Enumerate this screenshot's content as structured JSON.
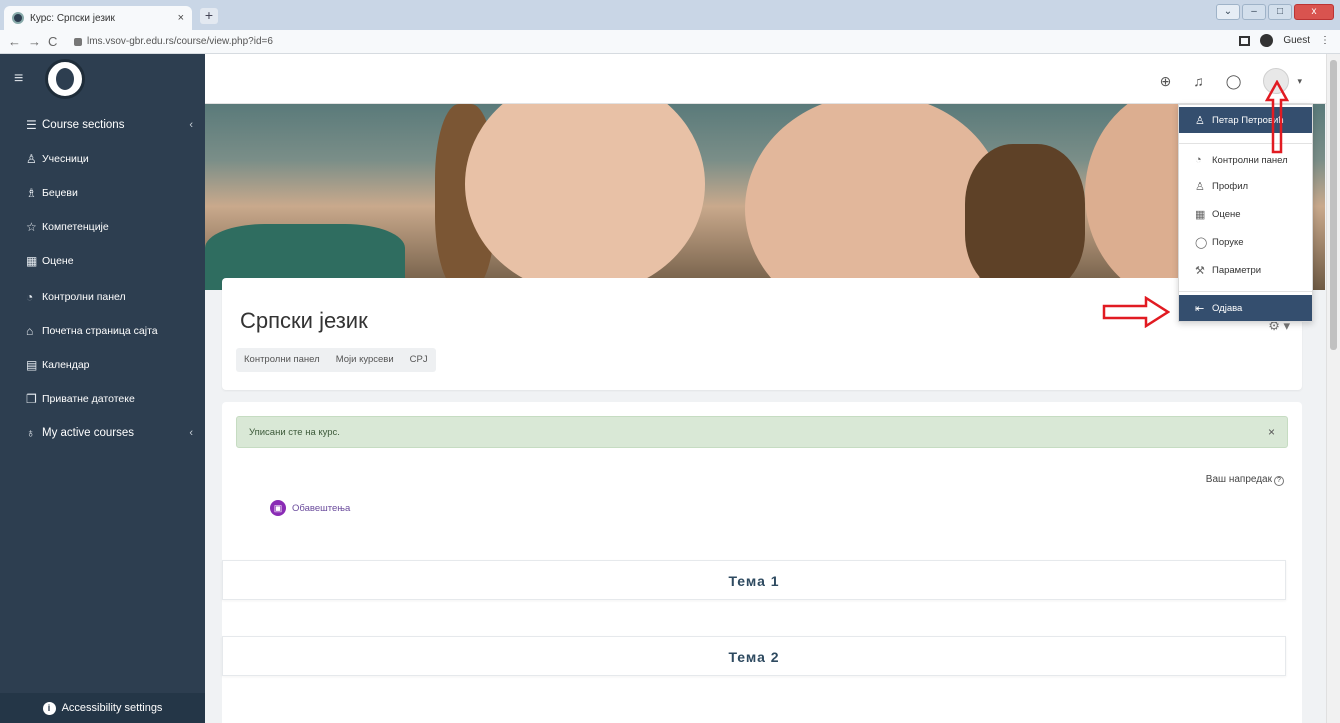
{
  "browser": {
    "tab_title": "Курс: Српски језик",
    "tab_close": "×",
    "new_tab": "+",
    "url": "lms.vsov-gbr.edu.rs/course/view.php?id=6",
    "profile_label": "Guest",
    "back": "←",
    "forward": "→",
    "reload": "C",
    "menu": "⋮"
  },
  "navbar": {
    "hamburger": "≡",
    "icons": [
      "globe-icon",
      "bell-icon",
      "chat-icon",
      "avatar"
    ],
    "caret": "▾"
  },
  "sidebar": {
    "items": [
      {
        "label": "Course sections",
        "icon": "list-icon",
        "chevron": "‹"
      },
      {
        "label": "Учесници",
        "icon": "users-icon"
      },
      {
        "label": "Беџеви",
        "icon": "badge-icon"
      },
      {
        "label": "Компетенције",
        "icon": "star-icon"
      },
      {
        "label": "Оцене",
        "icon": "grades-icon"
      },
      {
        "label": "Контролни панел",
        "icon": "dashboard-icon"
      },
      {
        "label": "Почетна страница сајта",
        "icon": "home-icon"
      },
      {
        "label": "Календар",
        "icon": "calendar-icon"
      },
      {
        "label": "Приватне датотеке",
        "icon": "files-icon"
      },
      {
        "label": "My active courses",
        "icon": "courses-icon",
        "chevron": "‹"
      }
    ],
    "accessibility": "Accessibility settings"
  },
  "course": {
    "title": "Српски језик",
    "breadcrumb": [
      "Контролни панел",
      "Моји курсеви",
      "СРЈ"
    ],
    "gear": "⚙ ▾"
  },
  "content": {
    "alert": "Уписани сте на курс.",
    "alert_close": "×",
    "progress": "Ваш напредак",
    "progress_help": "?",
    "forum": "Обавештења",
    "sections": [
      "Тема 1",
      "Тема 2"
    ]
  },
  "user_menu": {
    "name": "Петар Петровић",
    "items": [
      {
        "label": "Контролни панел",
        "icon": "dashboard-icon"
      },
      {
        "label": "Профил",
        "icon": "user-icon"
      },
      {
        "label": "Оцене",
        "icon": "grades-icon"
      },
      {
        "label": "Поруке",
        "icon": "chat-icon"
      },
      {
        "label": "Параметри",
        "icon": "wrench-icon"
      }
    ],
    "logout": "Одјава"
  },
  "colors": {
    "sidebar": "#2d3e50",
    "menu_active": "#344e6e",
    "alert_bg": "#d9e8d6",
    "annotation_red": "#e11b22"
  }
}
